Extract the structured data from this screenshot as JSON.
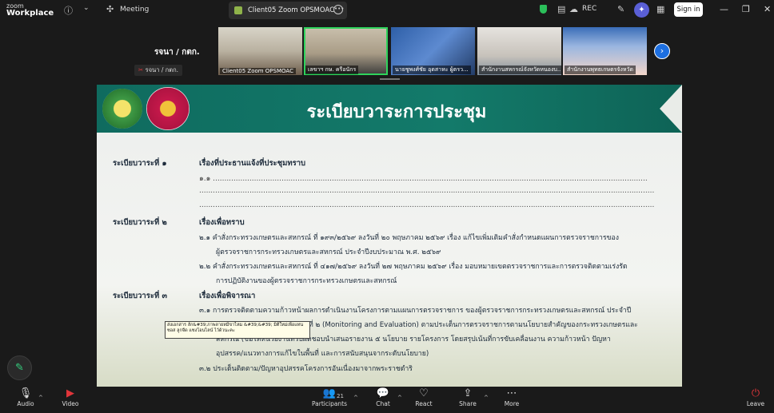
{
  "app": {
    "brand_small": "zoom",
    "brand_big": "Workplace"
  },
  "topbar": {
    "meeting_label": "Meeting",
    "tab_label": "Client05 Zoom OPSMOAC's scree",
    "rec_label": "REC",
    "signin_label": "Sign in"
  },
  "speaker": {
    "name": "รจนา / กตก.",
    "tag": "รจนา / กตก."
  },
  "thumbnails": [
    {
      "label": "Client05 Zoom OPSMOAC"
    },
    {
      "label": "เลขาฯ กษ. ครือนักร"
    },
    {
      "label": "นายชูพงศ์ชัย อุดสาหะ ผู้ตรว..."
    },
    {
      "label": "สำนักงานสหกรณ์จังหวัดหนองบ..."
    },
    {
      "label": "สำนักงานพุทธเกษตรจังหวัด"
    }
  ],
  "slide": {
    "title": "ระเบียบวาระการประชุม",
    "agenda": [
      {
        "heading": "ระเบียบวาระที่ ๑",
        "subject": "เรื่องที่ประธานแจ้งที่ประชุมทราบ",
        "lines": [
          "๑.๑ ..............................................................................................................................................................................................",
          ".......................................................................................................................................................................................................",
          "......................................................................................................................................................................................................."
        ]
      },
      {
        "heading": "ระเบียบวาระที่ ๒",
        "subject": "เรื่องเพื่อทราบ",
        "lines": [
          "๒.๑ คำสั่งกระทรวงเกษตรและสหกรณ์ ที่ ๑๙๓/๒๕๖๙ ลงวันที่ ๒๐ พฤษภาคม ๒๕๖๙ เรื่อง แก้ไขเพิ่มเติมคำสั่งกำหนดแผนการตรวจราชการของ",
          "ผู้ตรวจราชการกระทรวงเกษตรและสหกรณ์ ประจำปีงบประมาณ พ.ศ. ๒๕๖๙",
          "๒.๒ คำสั่งกระทรวงเกษตรและสหกรณ์ ที่ ๔๑๗/๒๕๖๙ ลงวันที่ ๒๗ พฤษภาคม ๒๕๖๙ เรื่อง มอบหมายเขตตรวจราชการและการตรวจติดตามเร่งรัด",
          "การปฏิบัติงานของผู้ตรวจราชการกระทรวงเกษตรและสหกรณ์"
        ]
      },
      {
        "heading": "ระเบียบวาระที่ ๓",
        "subject": "เรื่องเพื่อพิจารณา",
        "lines": [
          "๓.๑ การตรวจติดตามความก้าวหน้าผลการดำเนินงานโครงการตามแผนการตรวจราชการ ของผู้ตรวจราชการกระทรวงเกษตรและสหกรณ์ ประจำปี",
          "ที่ ๒ (Monitoring and Evaluation) ตามประเด็นการตรวจราชการตามนโยบายสำคัญของกระทรวงเกษตรและ",
          "สหกรณ์ (ขอให้หน่วยงานที่รับผิดชอบนำเสนอรายงาน ๕ นโยบาย รายโครงการ โดยสรุปเน้นที่การขับเคลื่อนงาน ความก้าวหน้า ปัญหา",
          "อุปสรรค/แนวทางการแก้ไขในพื้นที่ และการสนับสนุนจากระดับนโยบาย)",
          "๓.๒ ประเด็นติดตาม/ปัญหาอุปสรรคโครงการอันเนื่องมาจากพระราชดำริ"
        ]
      }
    ],
    "tooltip": "ส่งเอกสาร ลัก&#39;ภาพลายหมี่ขาไหม &#39;&#39; มิติใหม่เพื่อแทนซอส ลูกจีด แซงโอนไลน์ ไว้ด้วนะคะ"
  },
  "bottombar": {
    "audio": "Audio",
    "video": "Video",
    "participants": "Participants",
    "participants_count": "21",
    "chat": "Chat",
    "react": "React",
    "share": "Share",
    "more": "More",
    "leave": "Leave"
  },
  "colors": {
    "accent_green": "#2fd35c",
    "banner_teal": "#137a6a",
    "next_blue": "#1d6fe0",
    "leave_red": "#e0353a"
  }
}
